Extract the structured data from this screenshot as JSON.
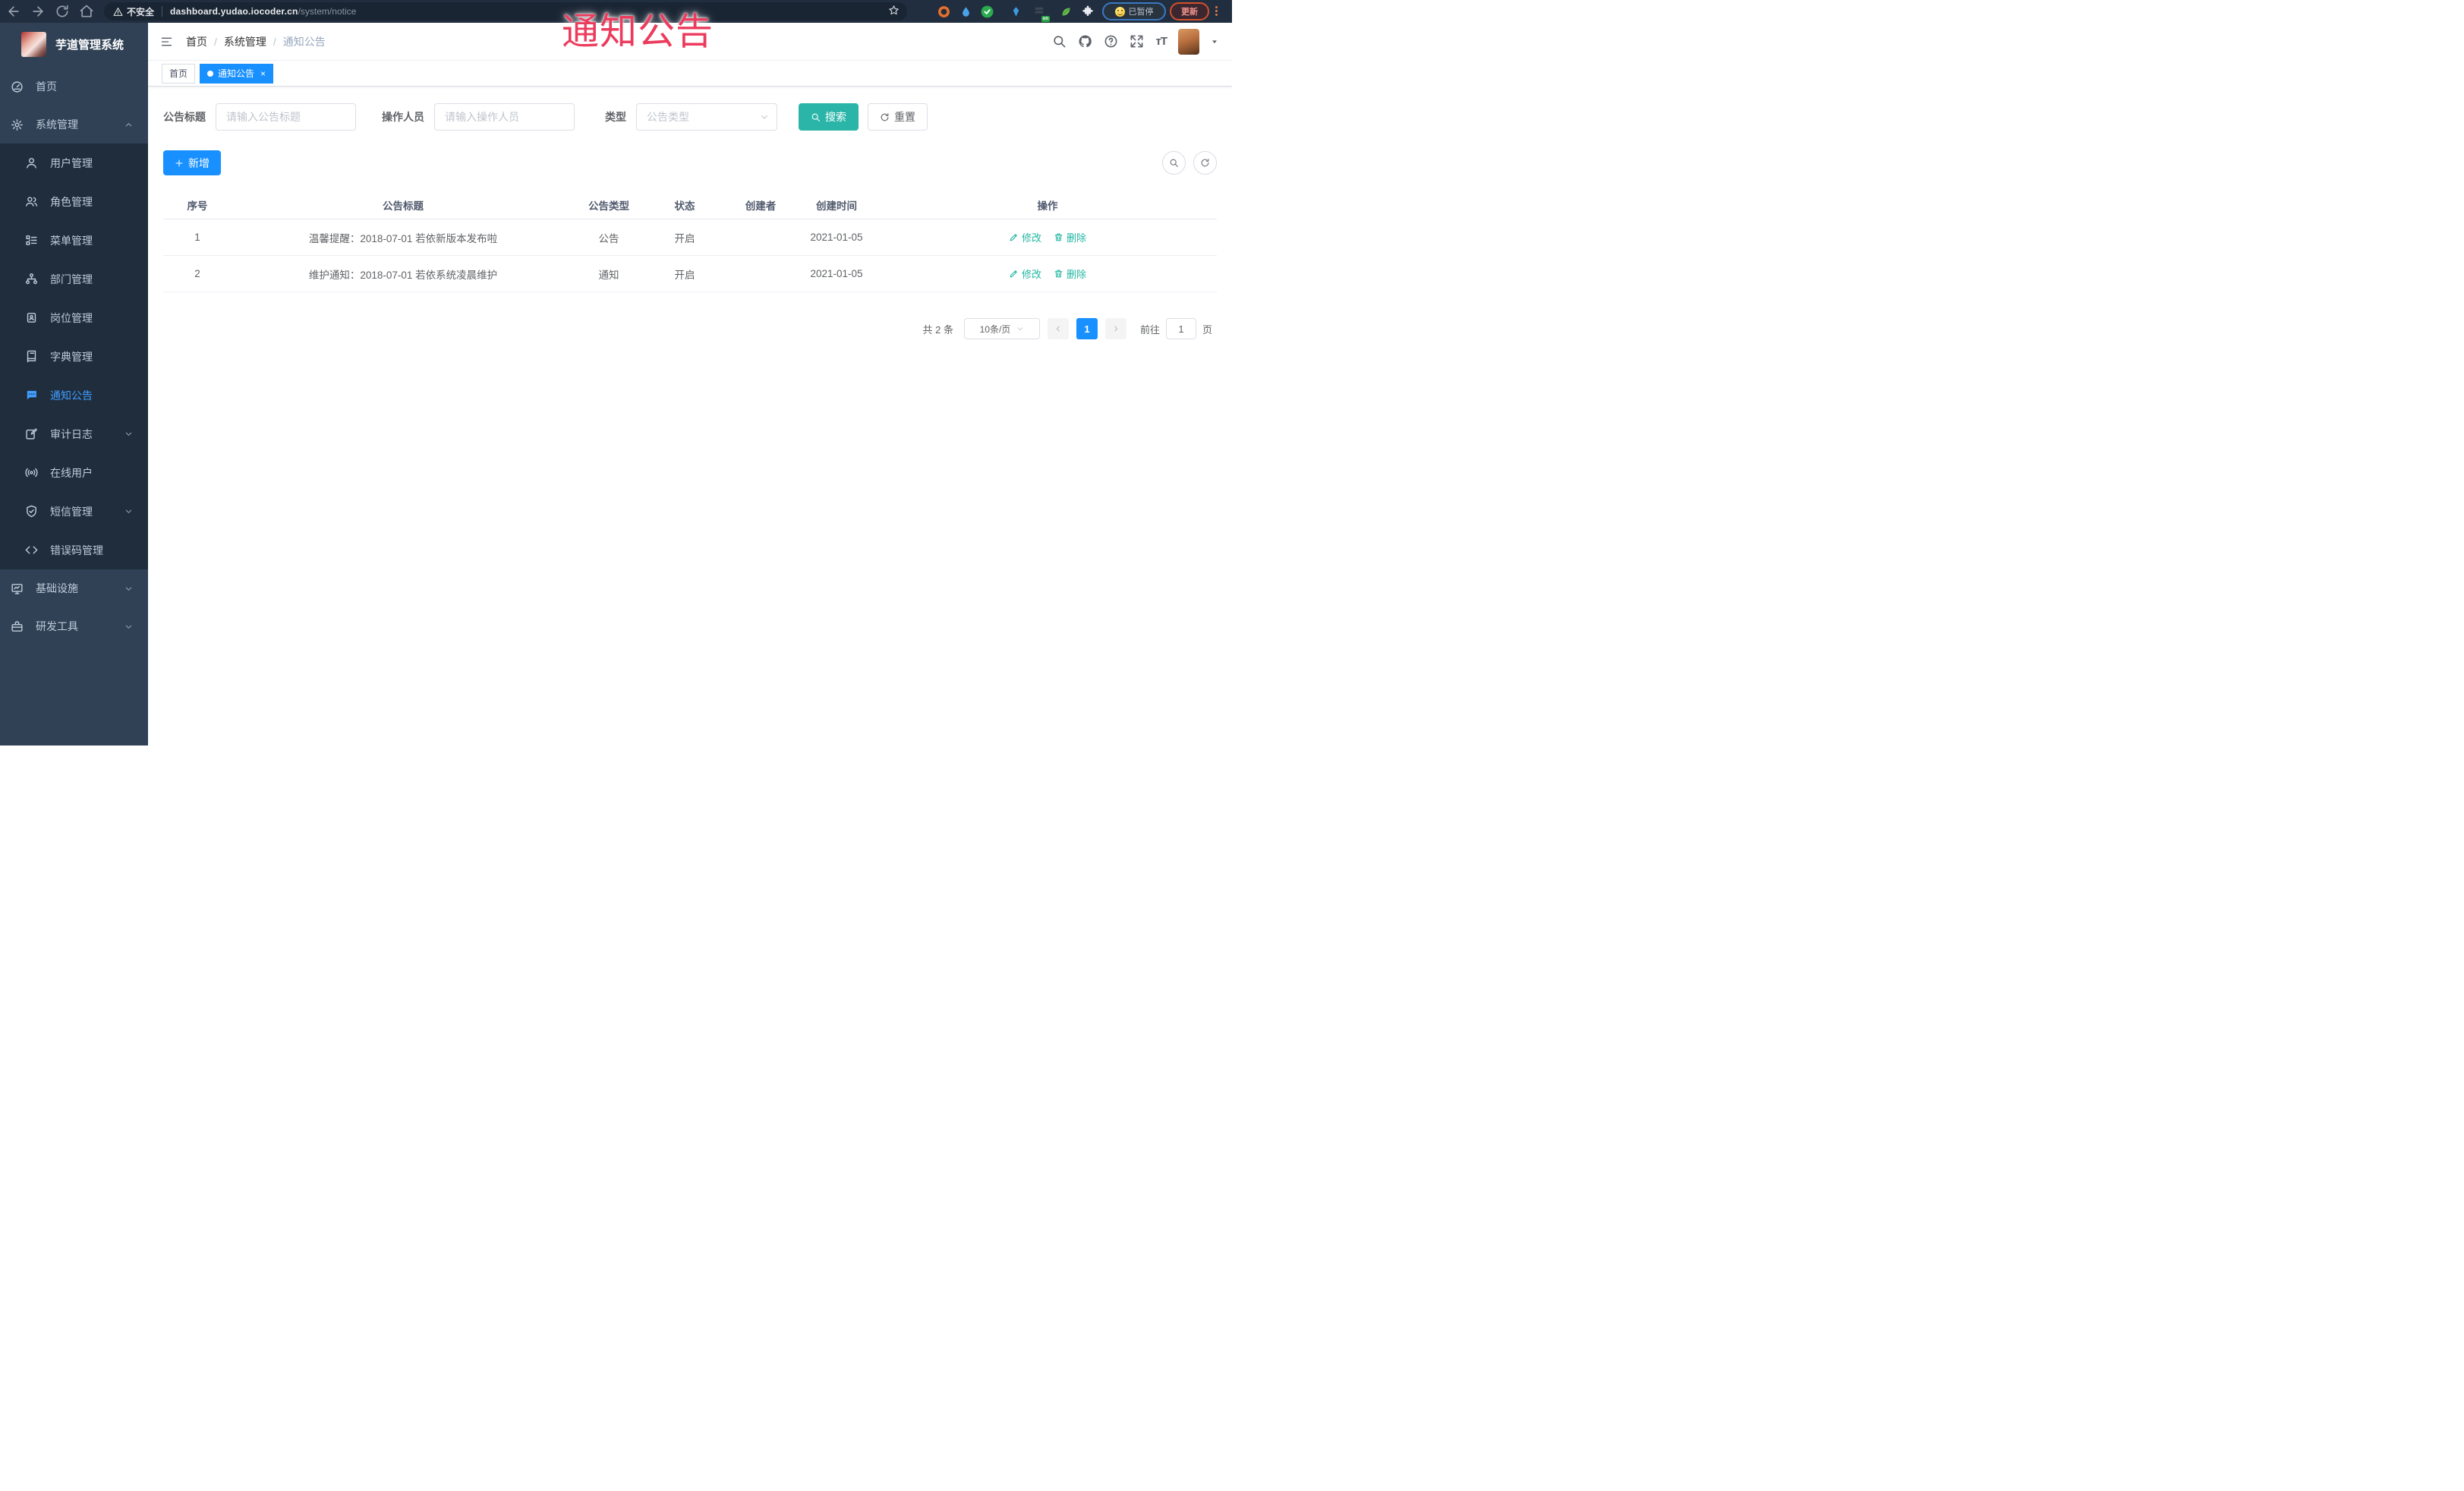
{
  "browser": {
    "security_warning": "不安全",
    "url_host": "dashboard.yudao.iocoder.cn",
    "url_path": "/system/notice",
    "paused_badge": "已暂停",
    "update_button": "更新"
  },
  "overlay": {
    "text": "通知公告",
    "color": "#ec3b5d"
  },
  "sidebar": {
    "app_title": "芋道管理系统",
    "items": [
      {
        "label": "首页",
        "icon": "dashboard-icon"
      },
      {
        "label": "系统管理",
        "icon": "gear-icon",
        "expanded": true
      },
      {
        "label": "用户管理",
        "icon": "user-icon"
      },
      {
        "label": "角色管理",
        "icon": "roles-icon"
      },
      {
        "label": "菜单管理",
        "icon": "menu-tree-icon"
      },
      {
        "label": "部门管理",
        "icon": "org-tree-icon"
      },
      {
        "label": "岗位管理",
        "icon": "post-badge-icon"
      },
      {
        "label": "字典管理",
        "icon": "dictionary-icon"
      },
      {
        "label": "通知公告",
        "icon": "message-icon",
        "active": true
      },
      {
        "label": "审计日志",
        "icon": "audit-log-icon",
        "collapsed": true
      },
      {
        "label": "在线用户",
        "icon": "online-users-icon"
      },
      {
        "label": "短信管理",
        "icon": "sms-shield-icon",
        "collapsed": true
      },
      {
        "label": "错误码管理",
        "icon": "code-icon"
      },
      {
        "label": "基础设施",
        "icon": "infrastructure-icon",
        "collapsed": true
      },
      {
        "label": "研发工具",
        "icon": "dev-tools-icon",
        "collapsed": true
      }
    ]
  },
  "header": {
    "breadcrumb": [
      "首页",
      "系统管理",
      "通知公告"
    ],
    "breadcrumb_separator": "/"
  },
  "tags": [
    {
      "label": "首页",
      "active": false
    },
    {
      "label": "通知公告",
      "active": true,
      "close": "×"
    }
  ],
  "form": {
    "filters": [
      {
        "label": "公告标题",
        "placeholder": "请输入公告标题"
      },
      {
        "label": "操作人员",
        "placeholder": "请输入操作人员"
      },
      {
        "label": "类型",
        "placeholder": "公告类型"
      }
    ],
    "search_label": "搜索",
    "reset_label": "重置"
  },
  "toolbar": {
    "add_label": "新增"
  },
  "table": {
    "columns": [
      "序号",
      "公告标题",
      "公告类型",
      "状态",
      "创建者",
      "创建时间",
      "操作"
    ],
    "edit_label": "修改",
    "delete_label": "删除",
    "rows": [
      {
        "no": "1",
        "title": "温馨提醒：2018-07-01 若依新版本发布啦",
        "type": "公告",
        "status": "开启",
        "creator": "",
        "created": "2021-01-05"
      },
      {
        "no": "2",
        "title": "维护通知：2018-07-01 若依系统凌晨维护",
        "type": "通知",
        "status": "开启",
        "creator": "",
        "created": "2021-01-05"
      }
    ]
  },
  "pagination": {
    "total": "共 2 条",
    "page_size": "10条/页",
    "current": "1",
    "goto_prefix": "前往",
    "goto_value": "1",
    "goto_suffix": "页"
  },
  "colors": {
    "accent": "#409EFF",
    "primary_button": "#1890ff",
    "search_button": "#2bb5a8",
    "action_link": "#23b7a3",
    "overlay_text": "#ec3b5d",
    "sidebar_bg": "#304156",
    "submenu_bg": "#1f2d3d"
  }
}
